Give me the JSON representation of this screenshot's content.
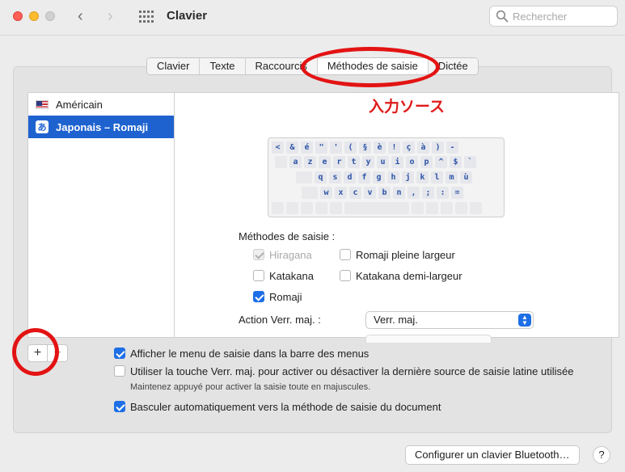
{
  "window": {
    "title": "Clavier"
  },
  "search": {
    "placeholder": "Rechercher"
  },
  "tabs": [
    {
      "label": "Clavier"
    },
    {
      "label": "Texte"
    },
    {
      "label": "Raccourcis"
    },
    {
      "label": "Méthodes de saisie",
      "active": true
    },
    {
      "label": "Dictée"
    }
  ],
  "sources": [
    {
      "label": "Américain",
      "icon": "us-flag-icon"
    },
    {
      "label": "Japonais – Romaji",
      "icon": "hiragana-a-icon",
      "selected": true,
      "glyph": "あ"
    }
  ],
  "annotation": {
    "text": "入力ソース",
    "color": "#e01b1b"
  },
  "keyboard": {
    "rows": [
      [
        "<",
        "&",
        "é",
        "\"",
        "'",
        "(",
        "§",
        "è",
        "!",
        "ç",
        "à",
        ")",
        "-"
      ],
      [
        "a",
        "z",
        "e",
        "r",
        "t",
        "y",
        "u",
        "i",
        "o",
        "p",
        "^",
        "$",
        "`"
      ],
      [
        "q",
        "s",
        "d",
        "f",
        "g",
        "h",
        "j",
        "k",
        "l",
        "m",
        "ù"
      ],
      [
        "w",
        "x",
        "c",
        "v",
        "b",
        "n",
        ",",
        ";",
        ":",
        "="
      ]
    ]
  },
  "input_methods": {
    "label": "Méthodes de saisie :",
    "options": [
      {
        "label": "Hiragana",
        "checked": true,
        "disabled": true
      },
      {
        "label": "Romaji pleine largeur",
        "checked": false
      },
      {
        "label": "Katakana",
        "checked": false
      },
      {
        "label": "Katakana demi-largeur",
        "checked": false
      },
      {
        "label": "Romaji",
        "checked": true
      }
    ]
  },
  "caps_lock": {
    "label": "Action Verr. maj. :",
    "value": "Verr. maj."
  },
  "list_controls": {
    "add": "+",
    "remove": "−"
  },
  "options": {
    "show_menu": {
      "label": "Afficher le menu de saisie dans la barre des menus",
      "checked": true
    },
    "caps_toggle": {
      "label": "Utiliser la touche Verr. maj. pour activer ou désactiver la dernière source de saisie latine utilisée",
      "checked": false
    },
    "caps_hint": "Maintenez appuyé pour activer la saisie toute en majuscules.",
    "auto_switch": {
      "label": "Basculer automatiquement vers la méthode de saisie du document",
      "checked": true
    }
  },
  "footer": {
    "bluetooth_button": "Configurer un clavier Bluetooth…",
    "help": "?"
  },
  "colors": {
    "accent": "#1e6ee5",
    "selection": "#1e62d0",
    "annotation_ring": "#e31313"
  }
}
